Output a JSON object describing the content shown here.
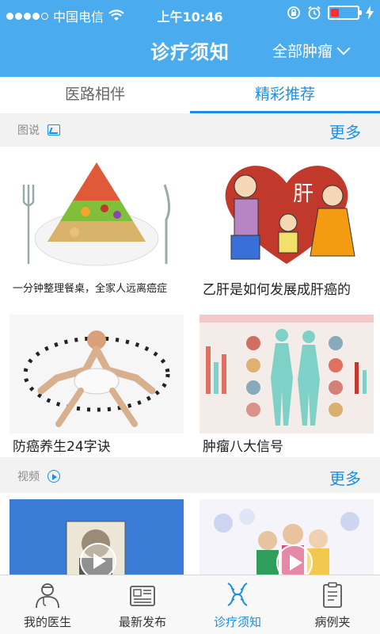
{
  "status_bar": {
    "carrier": "中国电信",
    "time": "上午10:46"
  },
  "header": {
    "title": "诊疗须知",
    "filter_label": "全部肿瘤"
  },
  "tabs": [
    {
      "label": "医路相伴",
      "active": false
    },
    {
      "label": "精彩推荐",
      "active": true
    }
  ],
  "sections": {
    "images": {
      "label": "图说",
      "more": "更多",
      "items": [
        {
          "caption": "一分钟整理餐桌，全家人远离癌症"
        },
        {
          "caption": "乙肝是如何发展成肝癌的"
        },
        {
          "caption": "防癌养生24字诀"
        },
        {
          "caption": "肿瘤八大信号"
        }
      ],
      "heart_text": "肝"
    },
    "videos": {
      "label": "视频",
      "more": "更多"
    }
  },
  "bottom_nav": [
    {
      "label": "我的医生",
      "icon": "doctor-icon",
      "active": false
    },
    {
      "label": "最新发布",
      "icon": "newspaper-icon",
      "active": false
    },
    {
      "label": "诊疗须知",
      "icon": "dna-icon",
      "active": true
    },
    {
      "label": "病例夹",
      "icon": "clipboard-icon",
      "active": false
    }
  ],
  "colors": {
    "header_bg": "#4aabee",
    "accent": "#1a8fe3"
  }
}
